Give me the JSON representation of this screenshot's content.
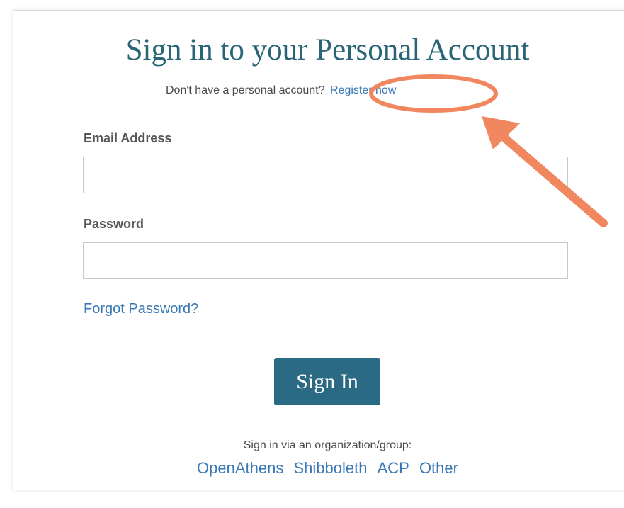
{
  "signin": {
    "title": "Sign in to your Personal Account",
    "register_prompt": "Don't have a personal account?",
    "register_link": "Register now",
    "email_label": "Email Address",
    "email_value": "",
    "password_label": "Password",
    "password_value": "",
    "forgot_link": "Forgot Password?",
    "submit_label": "Sign In"
  },
  "organization": {
    "caption": "Sign in via an organization/group:",
    "links": [
      "OpenAthens",
      "Shibboleth",
      "ACP",
      "Other"
    ]
  },
  "colors": {
    "title": "#2a6577",
    "link": "#3a78b5",
    "button": "#2a6a85",
    "annotation": "#f0875f"
  }
}
